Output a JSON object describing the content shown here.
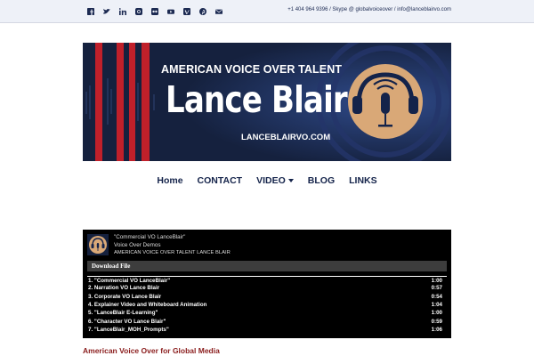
{
  "topbar": {
    "social_icons": [
      "facebook-icon",
      "twitter-icon",
      "linkedin-icon",
      "instagram-icon",
      "flickr-icon",
      "youtube-icon",
      "vimeo-icon",
      "pinterest-icon",
      "email-icon"
    ],
    "contact": "+1 404 964 9396 / Skype @ globalvoiceover / info@lanceblairvo.com"
  },
  "banner": {
    "tagline": "AMERICAN VOICE OVER TALENT",
    "name": "Lance Blair",
    "url": "LANCEBLAIRVO.COM",
    "logo_icon": "headphones-microphone-icon"
  },
  "nav": {
    "items": [
      "Home",
      "CONTACT",
      "VIDEO",
      "BLOG",
      "LINKS"
    ]
  },
  "player": {
    "title": "\"Commercial VO LanceBlair\"",
    "artist": "Voice Over Demos",
    "album": "AMERICAN VOICE OVER TALENT LANCE BLAIR",
    "download_label": "Download File",
    "tracks": [
      {
        "label": "1. \"Commercial VO LanceBlair\"",
        "duration": "1:00"
      },
      {
        "label": "2. Narration VO Lance Blair",
        "duration": "0:57"
      },
      {
        "label": "3. Corporate VO Lance Blair",
        "duration": "0:54"
      },
      {
        "label": "4. Explainer Video and Whiteboard Animation",
        "duration": "1:04"
      },
      {
        "label": "5. \"LanceBlair E-Learning\"",
        "duration": "1:00"
      },
      {
        "label": "6. \"Character VO Lance Blair\"",
        "duration": "0:59"
      },
      {
        "label": "7. \"LanceBlair_MOH_Prompts\"",
        "duration": "1:06"
      }
    ]
  },
  "section": {
    "heading": "American Voice Over for Global Media"
  },
  "colors": {
    "nav_text": "#14234a",
    "banner_bg": "#15213e",
    "banner_stripe": "#c0202a",
    "logo_circle": "#d9a877",
    "heading_red": "#8a1c1c"
  }
}
